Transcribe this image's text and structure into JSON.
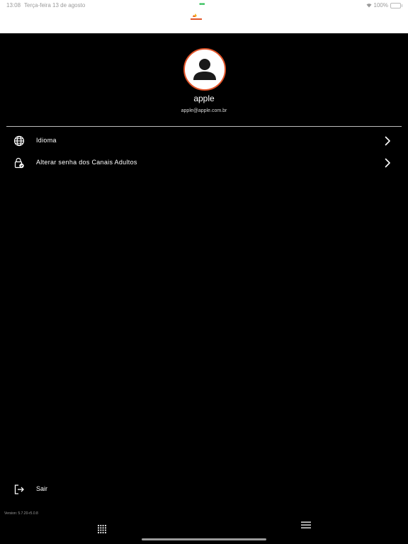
{
  "status_bar": {
    "time": "13:08",
    "date": "Terça-feira 13 de agosto",
    "battery": "100%"
  },
  "profile": {
    "name": "apple",
    "email": "apple@apple.com.br"
  },
  "menu": {
    "items": [
      {
        "label": "Idioma",
        "icon": "globe-icon"
      },
      {
        "label": "Alterar senha dos Canais Adultos",
        "icon": "lock-icon"
      }
    ]
  },
  "logout": {
    "label": "Sair",
    "icon": "logout-icon"
  },
  "footer": {
    "version": "Version: 5.7.20-r5.0.8"
  },
  "colors": {
    "background": "#000000",
    "accent": "#e2552a",
    "status_green": "#33c05a"
  }
}
